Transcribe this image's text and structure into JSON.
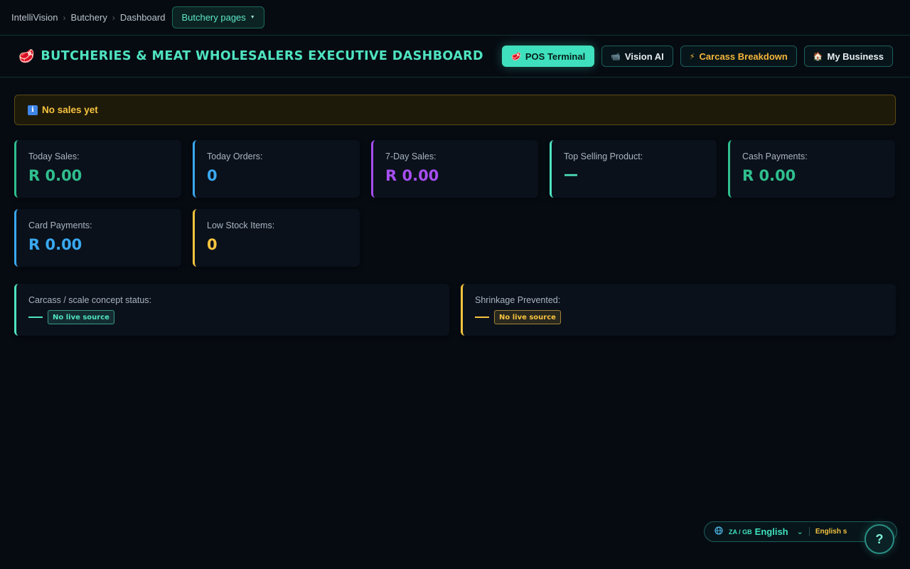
{
  "breadcrumb": {
    "items": [
      "IntelliVision",
      "Butchery",
      "Dashboard"
    ],
    "separator": "›",
    "pages_button": "Butchery pages",
    "pages_caret": "▼"
  },
  "header": {
    "title_icon": "🥩",
    "title": "BUTCHERIES & MEAT WHOLESALERS EXECUTIVE DASHBOARD",
    "nav": [
      {
        "label": "POS Terminal",
        "icon": "steak-icon",
        "glyph": "🥩"
      },
      {
        "label": "Vision AI",
        "icon": "camera-icon",
        "glyph": "📹"
      },
      {
        "label": "Carcass Breakdown",
        "icon": "bolt-icon",
        "glyph": "⚡"
      },
      {
        "label": "My Business",
        "icon": "home-icon",
        "glyph": "🏠"
      }
    ]
  },
  "alert": {
    "icon": "ℹ",
    "text": "No sales yet"
  },
  "kpis": [
    {
      "label": "Today Sales:",
      "value": "R 0.00",
      "color": "#2fbf8e"
    },
    {
      "label": "Today Orders:",
      "value": "0",
      "color": "#3aa8f0"
    },
    {
      "label": "7-Day Sales:",
      "value": "R 0.00",
      "color": "#a64ef0"
    },
    {
      "label": "Top Selling Product:",
      "value": "—",
      "color": "#4fe3c0"
    },
    {
      "label": "Cash Payments:",
      "value": "R 0.00",
      "color": "#2fbf8e"
    },
    {
      "label": "Card Payments:",
      "value": "R 0.00",
      "color": "#3aa8f0"
    },
    {
      "label": "Low Stock Items:",
      "value": "0",
      "color": "#f6c33e"
    }
  ],
  "status_cards": [
    {
      "label": "Carcass / scale concept status:",
      "badge": "No live source",
      "color": "#4fe3c0"
    },
    {
      "label": "Shrinkage Prevented:",
      "badge": "No live source",
      "color": "#f6c33e"
    }
  ],
  "language": {
    "icon": "globe-icon",
    "code": "ZA / GB",
    "name": "English",
    "chevron": "⌄",
    "note": "English s"
  },
  "help": {
    "label": "?"
  }
}
